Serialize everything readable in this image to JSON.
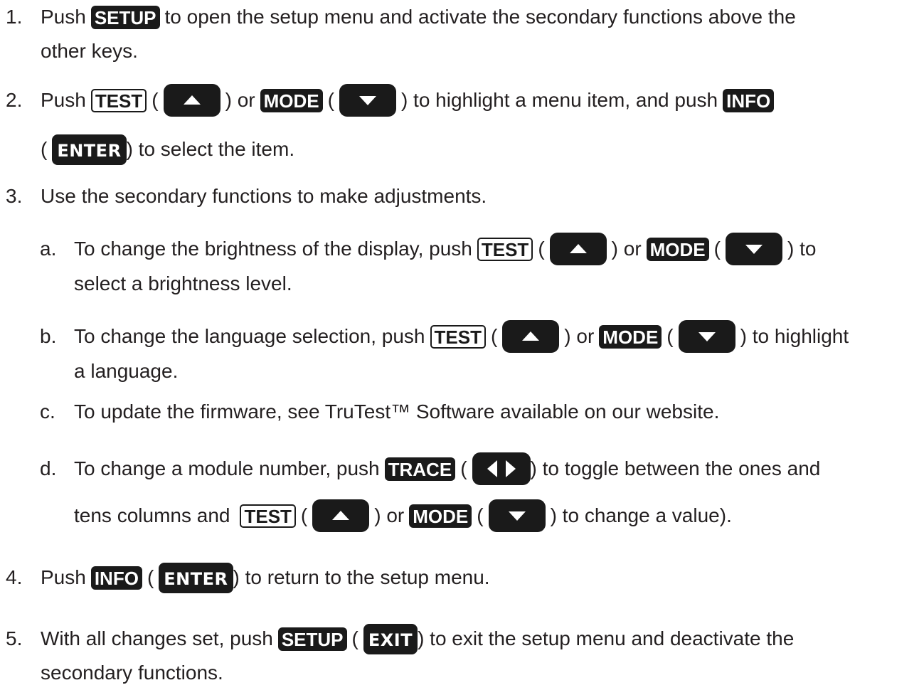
{
  "keys": {
    "setup": "SETUP",
    "test": "TEST",
    "mode": "MODE",
    "info": "INFO",
    "enter": "ENTER",
    "trace": "TRACE",
    "exit": "EXIT"
  },
  "icons": {
    "up": "up-arrow-icon",
    "down": "down-arrow-icon",
    "left_right": "left-right-arrows-icon"
  },
  "step1": {
    "num": "1.",
    "pre": "Push",
    "post": "to open the setup menu and activate the secondary functions above the",
    "cont": "other keys."
  },
  "step2": {
    "num": "2.",
    "pre": "Push",
    "p1": "(",
    "p2": ") or",
    "p3": "(",
    "p4": ") to highlight a menu item, and push",
    "cont_open": "(",
    "cont_post": ") to select the item."
  },
  "step3": {
    "num": "3.",
    "text": "Use the secondary functions to make adjustments."
  },
  "step3a": {
    "num": "a.",
    "pre": "To change the brightness of the display, push",
    "p1": "(",
    "p2": ") or",
    "p3": "(",
    "p4": ") to",
    "cont": "select a brightness level."
  },
  "step3b": {
    "num": "b.",
    "pre": "To change the language selection, push",
    "p1": "(",
    "p2": ") or",
    "p3": "(",
    "p4": ") to highlight",
    "cont": "a language."
  },
  "step3c": {
    "num": "c.",
    "text": "To update the firmware, see TruTest™ Software available on our website."
  },
  "step3d": {
    "num": "d.",
    "pre": "To change a module number, push",
    "p1": "(",
    "p2": ") to toggle between the ones and",
    "cont_pre": "tens columns and",
    "c1": "(",
    "c2": ") or",
    "c3": "(",
    "c4": ") to change a value)."
  },
  "step4": {
    "num": "4.",
    "pre": "Push",
    "p1": "(",
    "post": ") to return to the setup menu."
  },
  "step5": {
    "num": "5.",
    "pre": "With all changes set, push",
    "p1": "(",
    "post": ") to exit the setup menu and deactivate the",
    "cont": "secondary functions."
  }
}
